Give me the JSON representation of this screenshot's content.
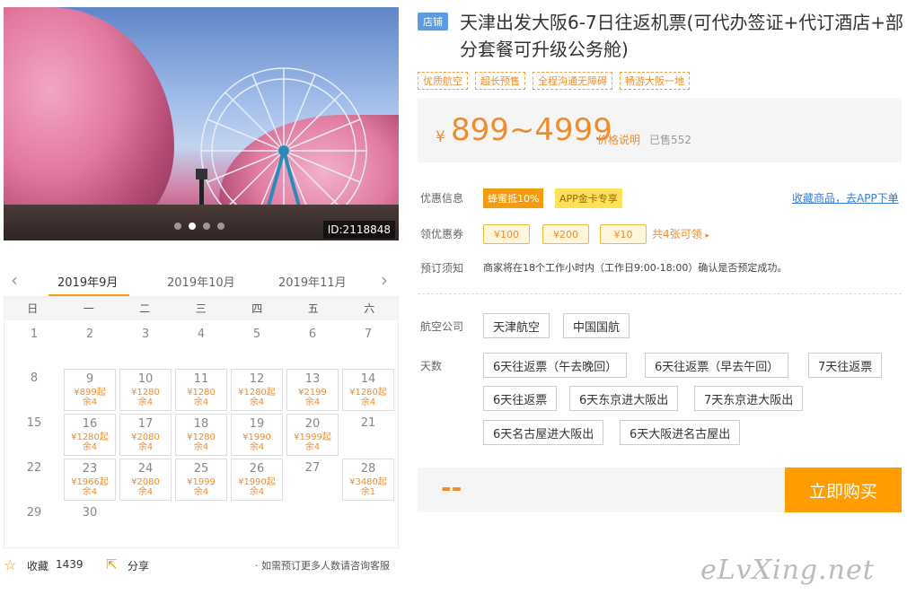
{
  "hero": {
    "image_id": "ID:2118848",
    "image_desc": "cherry-blossom-ferris-wheel"
  },
  "product": {
    "shop_badge": "店铺",
    "title": "天津出发大阪6-7日往返机票(可代办签证+代订酒店+部分套餐可升级公务舱)",
    "tags": [
      "优质航空",
      "超长预售",
      "全程沟通无障碍",
      "畅游大阪一地"
    ],
    "price_symbol": "¥",
    "price_range": "899~4999",
    "price_note": "价格说明",
    "sold": "已售552"
  },
  "offers": {
    "label": "优惠信息",
    "badge1": "蜂蜜抵10%",
    "badge2": "APP金卡专享",
    "fav_link": "收藏商品，去APP下单"
  },
  "coupons": {
    "label": "领优惠券",
    "items": [
      "¥100",
      "¥200",
      "¥10"
    ],
    "more": "共4张可领"
  },
  "booking_notice": {
    "label": "预订须知",
    "text": "商家将在18个工作小时内（工作日9:00-18:00）确认是否预定成功。"
  },
  "airline": {
    "label": "航空公司",
    "options": [
      "天津航空",
      "中国国航"
    ]
  },
  "days": {
    "label": "天数",
    "options": [
      "6天往返票（午去晚回）",
      "6天往返票（早去午回）",
      "7天往返票",
      "6天往返票",
      "6天东京进大阪出",
      "7天东京进大阪出",
      "6天名古屋进大阪出",
      "6天大阪进名古屋出"
    ]
  },
  "buy": {
    "placeholder": "--",
    "button": "立即购买"
  },
  "calendar": {
    "months": [
      "2019年9月",
      "2019年10月",
      "2019年11月"
    ],
    "active_month": 0,
    "weekdays": [
      "日",
      "一",
      "二",
      "三",
      "四",
      "五",
      "六"
    ],
    "days": [
      {
        "d": "1"
      },
      {
        "d": "2"
      },
      {
        "d": "3"
      },
      {
        "d": "4"
      },
      {
        "d": "5"
      },
      {
        "d": "6"
      },
      {
        "d": "7"
      },
      {
        "d": "8"
      },
      {
        "d": "9",
        "price": "¥899起",
        "rest": "余4"
      },
      {
        "d": "10",
        "price": "¥1280",
        "rest": "余4"
      },
      {
        "d": "11",
        "price": "¥1280",
        "rest": "余4"
      },
      {
        "d": "12",
        "price": "¥1280起",
        "rest": "余4"
      },
      {
        "d": "13",
        "price": "¥2199",
        "rest": "余4"
      },
      {
        "d": "14",
        "price": "¥1280起",
        "rest": "余4"
      },
      {
        "d": "15"
      },
      {
        "d": "16",
        "price": "¥1280起",
        "rest": "余4"
      },
      {
        "d": "17",
        "price": "¥2080",
        "rest": "余4"
      },
      {
        "d": "18",
        "price": "¥1280",
        "rest": "余4"
      },
      {
        "d": "19",
        "price": "¥1990",
        "rest": "余4"
      },
      {
        "d": "20",
        "price": "¥1999起",
        "rest": "余4"
      },
      {
        "d": "21"
      },
      {
        "d": "22"
      },
      {
        "d": "23",
        "price": "¥1966起",
        "rest": "余4"
      },
      {
        "d": "24",
        "price": "¥2080",
        "rest": "余4"
      },
      {
        "d": "25",
        "price": "¥1999",
        "rest": "余4"
      },
      {
        "d": "26",
        "price": "¥1990起",
        "rest": "余4"
      },
      {
        "d": "27"
      },
      {
        "d": "28",
        "price": "¥3480起",
        "rest": "余1"
      },
      {
        "d": "29"
      },
      {
        "d": "30"
      }
    ]
  },
  "footer": {
    "favorite_label": "收藏",
    "favorite_count": "1439",
    "share_label": "分享",
    "consult": "· 如需预订更多人数请咨询客服"
  },
  "watermark": "eLvXing.net"
}
